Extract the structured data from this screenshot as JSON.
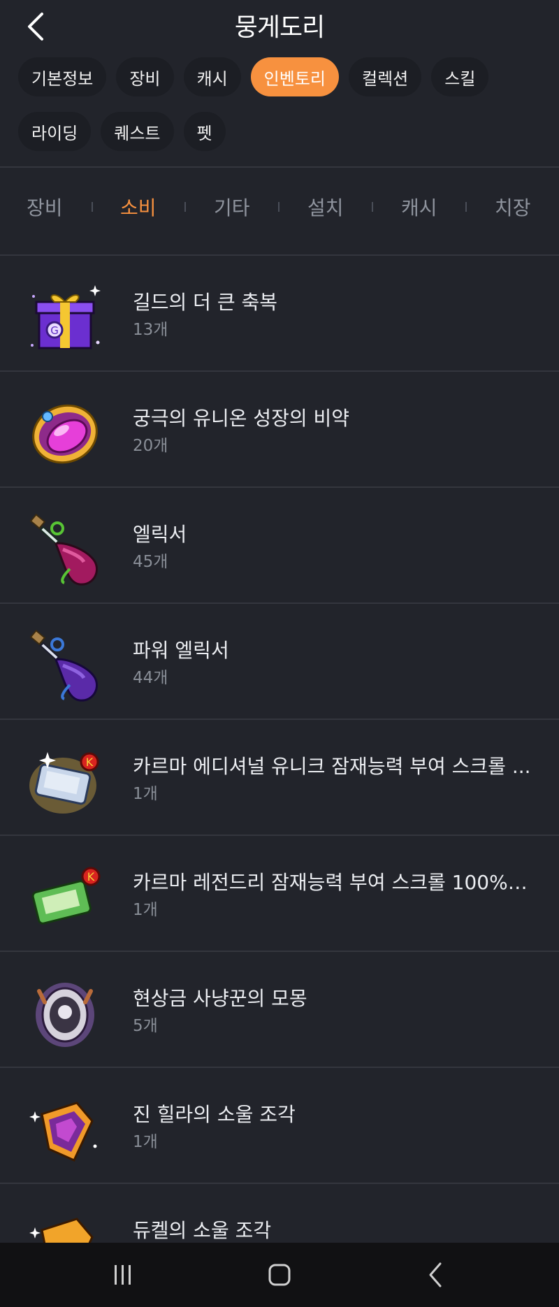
{
  "header": {
    "title": "뭉게도리"
  },
  "chips": [
    [
      "기본정보",
      "장비",
      "캐시",
      "인벤토리",
      "컬렉션",
      "스킬"
    ],
    [
      "라이딩",
      "퀘스트",
      "펫"
    ]
  ],
  "active_chip": "인벤토리",
  "tabs": [
    "장비",
    "소비",
    "기타",
    "설치",
    "캐시",
    "치장"
  ],
  "active_tab": "소비",
  "items": [
    {
      "name": "길드의 더 큰 축복",
      "count": "13개",
      "icon": "guild-gift-box-icon"
    },
    {
      "name": "궁극의 유니온 성장의 비약",
      "count": "20개",
      "icon": "union-gem-icon"
    },
    {
      "name": "엘릭서",
      "count": "45개",
      "icon": "elixir-potion-icon"
    },
    {
      "name": "파워 엘릭서",
      "count": "44개",
      "icon": "power-elixir-potion-icon"
    },
    {
      "name": "카르마 에디셔널 유니크 잠재능력 부여 스크롤 ...",
      "count": "1개",
      "icon": "karma-additional-scroll-icon"
    },
    {
      "name": "카르마 레전드리 잠재능력 부여 스크롤 100% ...",
      "count": "1개",
      "icon": "karma-legendary-scroll-icon"
    },
    {
      "name": "현상금 사냥꾼의 모몽",
      "count": "5개",
      "icon": "bounty-hunter-egg-icon"
    },
    {
      "name": "진 힐라의 소울 조각",
      "count": "1개",
      "icon": "hilla-soul-shard-icon"
    },
    {
      "name": "듀켈의 소울 조각",
      "count": "",
      "icon": "dunkel-soul-shard-icon"
    }
  ],
  "colors": {
    "accent": "#f7913f",
    "background": "#22242b",
    "navbar": "#111113"
  }
}
